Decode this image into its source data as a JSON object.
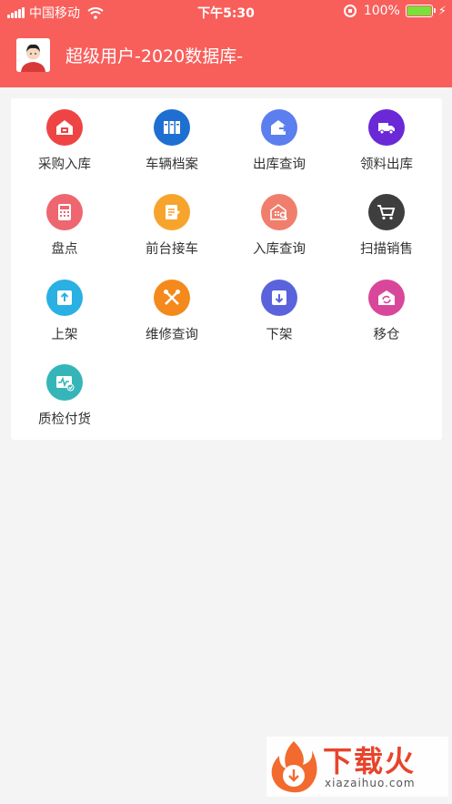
{
  "status_bar": {
    "carrier": "中国移动",
    "time": "下午5:30",
    "battery": "100%",
    "battery_level": 1.0
  },
  "header": {
    "title": "超级用户-2020数据库-",
    "avatar": "user-avatar"
  },
  "grid": {
    "items": [
      {
        "label": "采购入库",
        "icon": "purchase-warehouse-icon",
        "color": "#ef4444"
      },
      {
        "label": "车辆档案",
        "icon": "vehicle-file-icon",
        "color": "#1e6fd1"
      },
      {
        "label": "出库查询",
        "icon": "outbound-query-icon",
        "color": "#5b7fef"
      },
      {
        "label": "领料出库",
        "icon": "material-truck-icon",
        "color": "#6a28d6"
      },
      {
        "label": "盘点",
        "icon": "inventory-calculator-icon",
        "color": "#ee6670"
      },
      {
        "label": "前台接车",
        "icon": "reception-note-icon",
        "color": "#f7a42d"
      },
      {
        "label": "入库查询",
        "icon": "inbound-query-icon",
        "color": "#f07e6c"
      },
      {
        "label": "扫描销售",
        "icon": "scan-cart-icon",
        "color": "#3e3e3e"
      },
      {
        "label": "上架",
        "icon": "shelve-up-icon",
        "color": "#2ab0e2"
      },
      {
        "label": "维修查询",
        "icon": "repair-tools-icon",
        "color": "#f48a1c"
      },
      {
        "label": "下架",
        "icon": "shelve-down-icon",
        "color": "#5a63db"
      },
      {
        "label": "移仓",
        "icon": "transfer-warehouse-icon",
        "color": "#d9479a"
      },
      {
        "label": "质检付货",
        "icon": "quality-check-icon",
        "color": "#36b5b8"
      }
    ]
  },
  "watermark": {
    "brand": "下载火",
    "url": "xiazaihuo.com"
  }
}
